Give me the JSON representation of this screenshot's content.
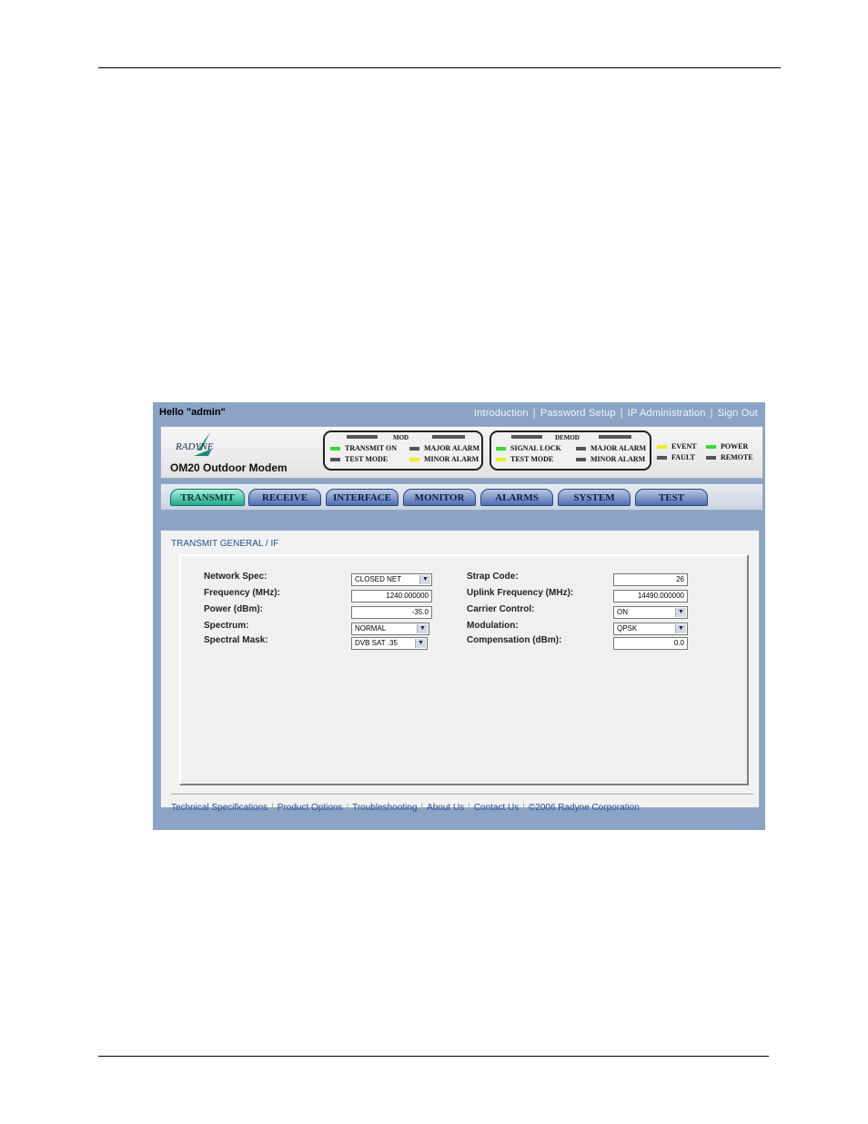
{
  "top_bar": {
    "greeting": "Hello \"admin\"",
    "links": [
      "Introduction",
      "Password Setup",
      "IP Administration",
      "Sign Out"
    ]
  },
  "header": {
    "logo_text": "RADYNE",
    "product_name": "OM20 Outdoor Modem",
    "mod_panel": {
      "title": "MOD",
      "leds": [
        {
          "label": "TRANSMIT ON",
          "color": "#33dd33"
        },
        {
          "label": "MAJOR ALARM",
          "color": "#555555"
        },
        {
          "label": "TEST MODE",
          "color": "#555555"
        },
        {
          "label": "MINOR ALARM",
          "color": "#eeee22"
        }
      ]
    },
    "demod_panel": {
      "title": "DEMOD",
      "leds": [
        {
          "label": "SIGNAL LOCK",
          "color": "#33dd33"
        },
        {
          "label": "MAJOR ALARM",
          "color": "#555555"
        },
        {
          "label": "TEST MODE",
          "color": "#eeee22"
        },
        {
          "label": "MINOR ALARM",
          "color": "#555555"
        }
      ]
    },
    "status_leds": [
      {
        "label": "EVENT",
        "color": "#eeee22"
      },
      {
        "label": "POWER",
        "color": "#33dd33"
      },
      {
        "label": "FAULT",
        "color": "#555555"
      },
      {
        "label": "REMOTE",
        "color": "#555555"
      }
    ]
  },
  "tabs": [
    {
      "label": "TRANSMIT",
      "active": true
    },
    {
      "label": "RECEIVE",
      "active": false
    },
    {
      "label": "INTERFACE",
      "active": false
    },
    {
      "label": "MONITOR",
      "active": false
    },
    {
      "label": "ALARMS",
      "active": false
    },
    {
      "label": "SYSTEM",
      "active": false
    },
    {
      "label": "TEST",
      "active": false
    }
  ],
  "section_title": "TRANSMIT GENERAL / IF",
  "form": {
    "network_spec": {
      "label": "Network Spec:",
      "value": "CLOSED NET"
    },
    "frequency": {
      "label": "Frequency (MHz):",
      "value": "1240.000000"
    },
    "power": {
      "label": "Power (dBm):",
      "value": "-35.0"
    },
    "spectrum": {
      "label": "Spectrum:",
      "value": "NORMAL"
    },
    "spectral_mask": {
      "label": "Spectral Mask:",
      "value": "DVB SAT .35"
    },
    "strap_code": {
      "label": "Strap Code:",
      "value": "26"
    },
    "uplink_frequency": {
      "label": "Uplink Frequency (MHz):",
      "value": "14490.000000"
    },
    "carrier_control": {
      "label": "Carrier Control:",
      "value": "ON"
    },
    "modulation": {
      "label": "Modulation:",
      "value": "QPSK"
    },
    "compensation": {
      "label": "Compensation (dBm):",
      "value": "0.0"
    }
  },
  "footer": {
    "links": [
      "Technical Specifications",
      "Product Options",
      "Troubleshooting",
      "About Us",
      "Contact Us"
    ],
    "copyright": "©2006 Radyne Corporation"
  }
}
